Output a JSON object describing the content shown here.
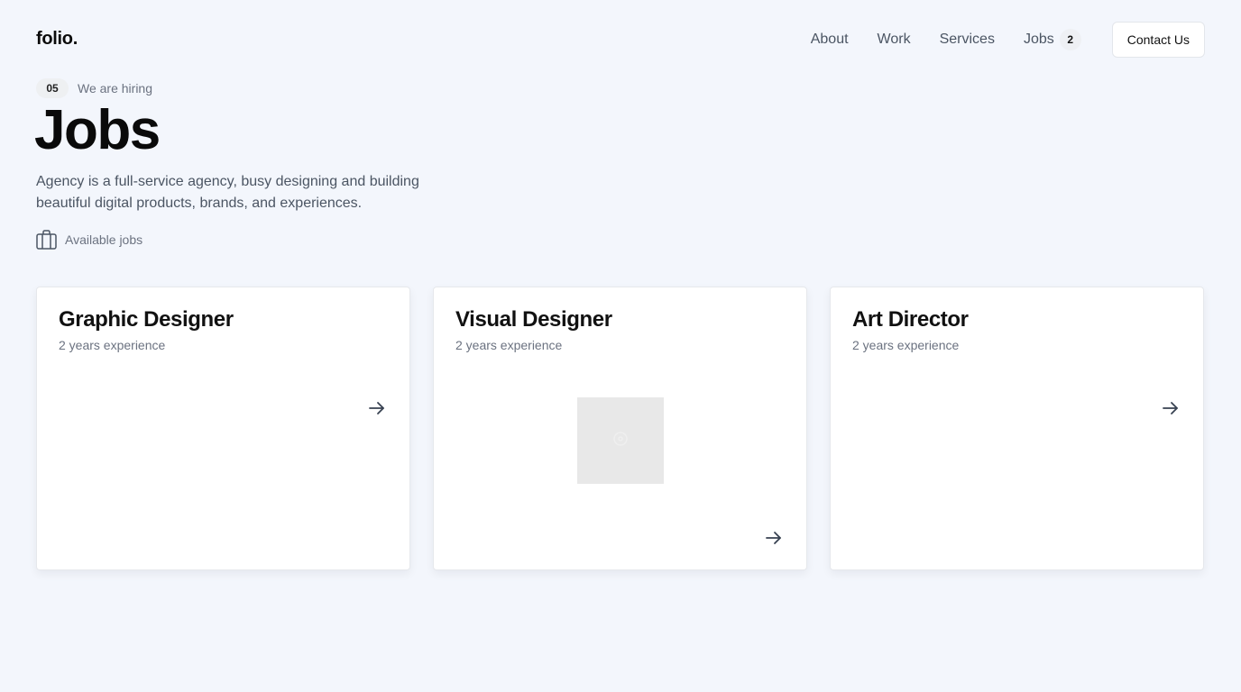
{
  "header": {
    "logo": "folio.",
    "nav": [
      {
        "label": "About"
      },
      {
        "label": "Work"
      },
      {
        "label": "Services"
      },
      {
        "label": "Jobs",
        "badge": "2"
      }
    ],
    "contact_label": "Contact Us"
  },
  "hero": {
    "section_number": "05",
    "eyebrow": "We are hiring",
    "title": "Jobs",
    "description": "Agency is a full-service agency, busy designing and building beautiful digital products, brands, and experiences.",
    "available_label": "Available jobs"
  },
  "jobs": [
    {
      "title": "Graphic Designer",
      "subtitle": "2 years experience"
    },
    {
      "title": "Visual Designer",
      "subtitle": "2 years experience"
    },
    {
      "title": "Art Director",
      "subtitle": "2 years experience"
    }
  ],
  "icons": {
    "available": "briefcase-icon",
    "card_link": "arrow-right-icon",
    "image_placeholder": "image-placeholder-icon"
  },
  "colors": {
    "background": "#f3f6fc",
    "text_primary": "#111111",
    "text_muted": "#6b7280",
    "card_background": "#ffffff"
  }
}
